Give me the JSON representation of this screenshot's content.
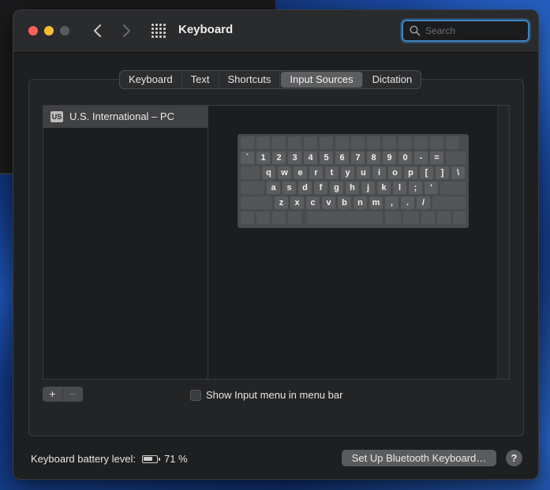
{
  "window": {
    "title": "Keyboard",
    "search_placeholder": "Search"
  },
  "tabs": [
    {
      "label": "Keyboard",
      "active": false
    },
    {
      "label": "Text",
      "active": false
    },
    {
      "label": "Shortcuts",
      "active": false
    },
    {
      "label": "Input Sources",
      "active": true
    },
    {
      "label": "Dictation",
      "active": false
    }
  ],
  "input_sources": {
    "items": [
      {
        "flag": "US",
        "label": "U.S. International – PC",
        "selected": true
      }
    ]
  },
  "keyboard_preview": {
    "row1": [
      "`",
      "1",
      "2",
      "3",
      "4",
      "5",
      "6",
      "7",
      "8",
      "9",
      "0",
      "-",
      "="
    ],
    "row2": [
      "q",
      "w",
      "e",
      "r",
      "t",
      "y",
      "u",
      "i",
      "o",
      "p",
      "[",
      "]",
      "\\"
    ],
    "row3": [
      "a",
      "s",
      "d",
      "f",
      "g",
      "h",
      "j",
      "k",
      "l",
      ";",
      "'"
    ],
    "row4": [
      "z",
      "x",
      "c",
      "v",
      "b",
      "n",
      "m",
      ",",
      ".",
      "/"
    ]
  },
  "controls": {
    "add_label": "+",
    "remove_label": "−",
    "show_menu_label": "Show Input menu in menu bar",
    "show_menu_checked": false
  },
  "footer": {
    "battery_label": "Keyboard battery level:",
    "battery_percent": "71 %",
    "battery_level": 0.71,
    "bluetooth_button": "Set Up Bluetooth Keyboard…",
    "help_label": "?"
  }
}
